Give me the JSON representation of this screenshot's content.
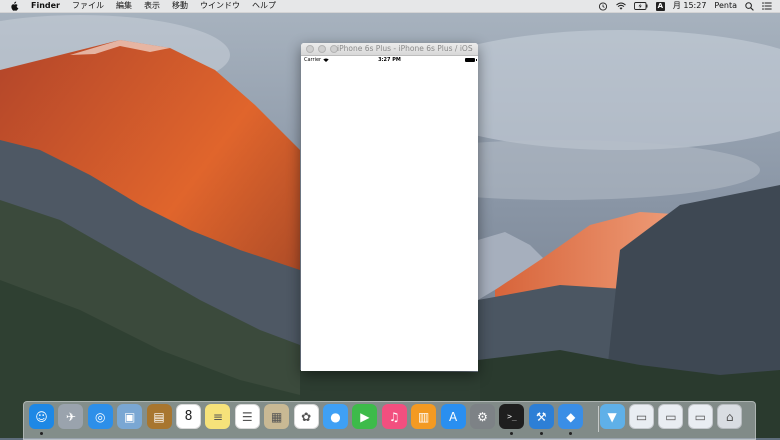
{
  "menubar": {
    "app_name": "Finder",
    "menus": [
      "ファイル",
      "編集",
      "表示",
      "移動",
      "ウインドウ",
      "ヘルプ"
    ],
    "input_source": "A",
    "clock": "月 15:27",
    "user": "Penta"
  },
  "simulator": {
    "title": "iPhone 6s Plus - iPhone 6s Plus / iOS 9.3 (13E230)",
    "status_bar": {
      "carrier": "Carrier",
      "time": "3:27 PM"
    }
  },
  "dock": {
    "items": [
      {
        "name": "finder",
        "icon": "finder-icon",
        "bg": "#1e88e5",
        "running": true
      },
      {
        "name": "launchpad",
        "icon": "rocket-icon",
        "bg": "#9aa3ad",
        "running": false
      },
      {
        "name": "safari",
        "icon": "compass-icon",
        "bg": "#2d8fe9",
        "running": false
      },
      {
        "name": "preview",
        "icon": "photo-viewer-icon",
        "bg": "#7aa7d3",
        "running": false
      },
      {
        "name": "contacts",
        "icon": "address-book-icon",
        "bg": "#a8762f",
        "running": false
      },
      {
        "name": "calendar",
        "icon": "calendar-icon",
        "bg": "#ffffff",
        "running": false,
        "label": "8"
      },
      {
        "name": "notes",
        "icon": "notes-icon",
        "bg": "#f6e27a",
        "running": false
      },
      {
        "name": "reminders",
        "icon": "reminders-icon",
        "bg": "#ffffff",
        "running": false
      },
      {
        "name": "photo-slideshow",
        "icon": "image-collage-icon",
        "bg": "#c9b994",
        "running": false
      },
      {
        "name": "photos",
        "icon": "photos-flower-icon",
        "bg": "#ffffff",
        "running": false
      },
      {
        "name": "messages",
        "icon": "speech-bubble-icon",
        "bg": "#3fa0f5",
        "running": false
      },
      {
        "name": "facetime",
        "icon": "video-camera-icon",
        "bg": "#3dbb4a",
        "running": false
      },
      {
        "name": "itunes",
        "icon": "music-note-icon",
        "bg": "#f24f7f",
        "running": false
      },
      {
        "name": "ibooks",
        "icon": "book-icon",
        "bg": "#f39a22",
        "running": false
      },
      {
        "name": "app-store",
        "icon": "app-store-icon",
        "bg": "#2a8ff0",
        "running": false
      },
      {
        "name": "system-preferences",
        "icon": "gear-icon",
        "bg": "#7d8286",
        "running": false
      },
      {
        "name": "terminal",
        "icon": "terminal-icon",
        "bg": "#1e1e1e",
        "running": true,
        "label": ">_"
      },
      {
        "name": "xcode",
        "icon": "hammer-icon",
        "bg": "#2d7fd6",
        "running": true
      },
      {
        "name": "simulator",
        "icon": "simulator-icon",
        "bg": "#3a8ee6",
        "running": true
      },
      {
        "name": "downloads-folder",
        "icon": "folder-icon",
        "bg": "#5fb0e8",
        "running": false
      },
      {
        "name": "stack-1",
        "icon": "document-stack-icon",
        "bg": "#e9edf2",
        "running": false
      },
      {
        "name": "stack-2",
        "icon": "document-stack-icon",
        "bg": "#e9edf2",
        "running": false
      },
      {
        "name": "stack-3",
        "icon": "document-stack-icon",
        "bg": "#e9edf2",
        "running": false
      },
      {
        "name": "trash",
        "icon": "trash-icon",
        "bg": "#d9dde2",
        "running": false
      }
    ]
  }
}
